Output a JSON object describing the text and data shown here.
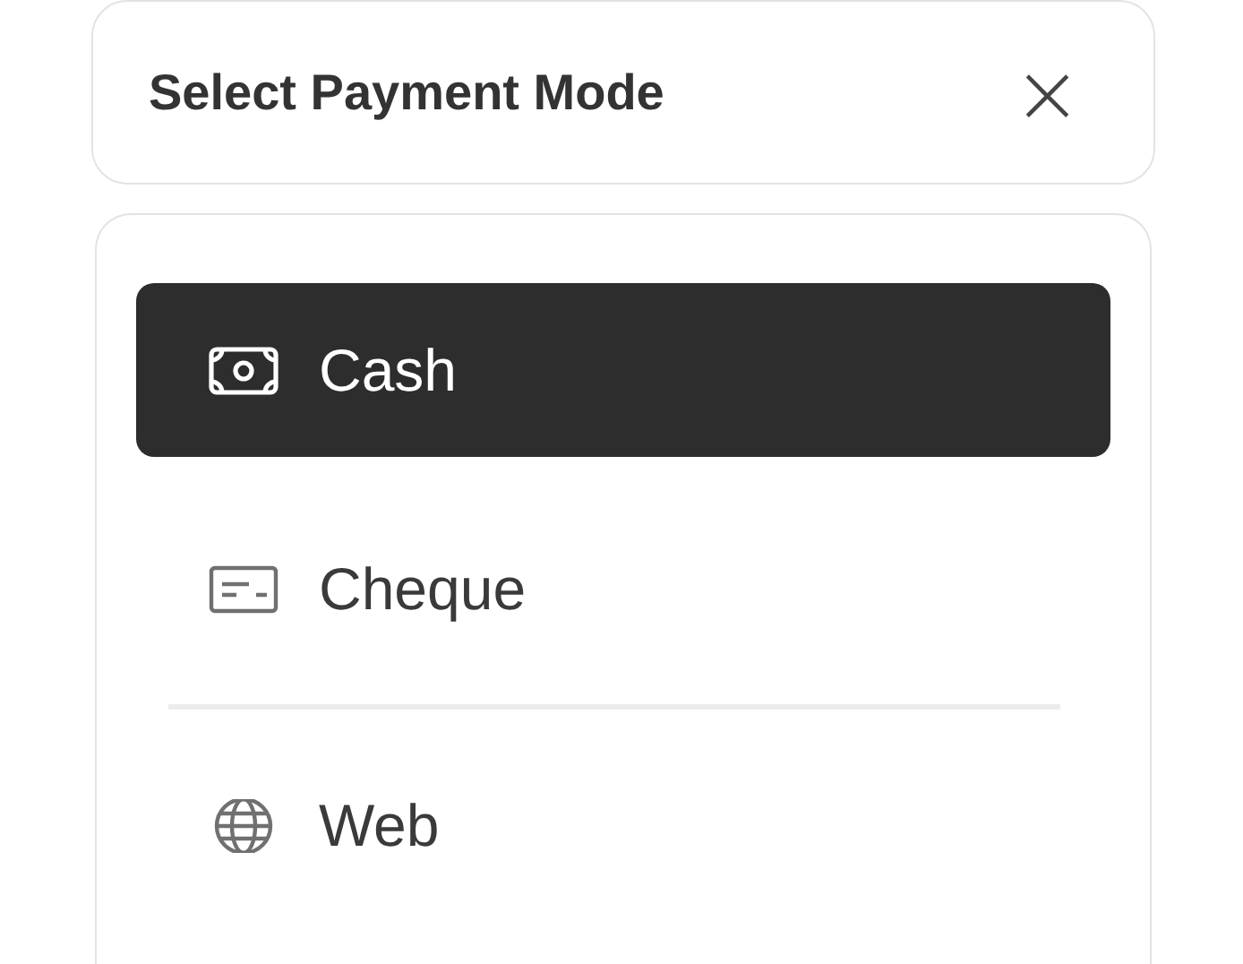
{
  "dialog": {
    "title": "Select Payment Mode",
    "close": "×"
  },
  "modes": [
    {
      "label": "Cash",
      "kind": "cash",
      "selected": true,
      "separated": false
    },
    {
      "label": "Cheque",
      "kind": "cheque",
      "selected": false,
      "separated": false
    },
    {
      "label": "Web",
      "kind": "web",
      "selected": false,
      "separated": true
    }
  ]
}
